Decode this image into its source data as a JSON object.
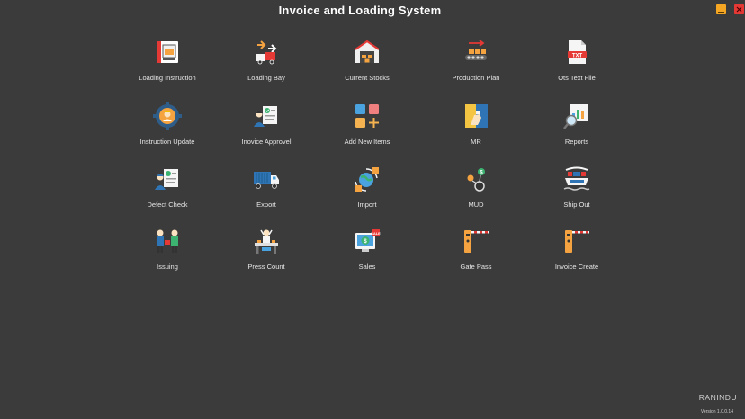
{
  "window": {
    "title": "Invoice and Loading System",
    "minimize_color": "#f5a623",
    "close_color": "#e53935"
  },
  "menu": [
    {
      "label": "Loading Instruction",
      "icon": "loading-instruction-icon"
    },
    {
      "label": "Loading Bay",
      "icon": "loading-bay-icon"
    },
    {
      "label": "Current Stocks",
      "icon": "warehouse-icon"
    },
    {
      "label": "Production Plan",
      "icon": "conveyor-icon"
    },
    {
      "label": "Ots Text File",
      "icon": "txt-file-icon"
    },
    {
      "label": "Instruction  Update",
      "icon": "gear-worker-icon"
    },
    {
      "label": "Inovice Approvel",
      "icon": "approval-icon"
    },
    {
      "label": "Add New Items",
      "icon": "add-items-icon"
    },
    {
      "label": "MR",
      "icon": "mr-icon"
    },
    {
      "label": "Reports",
      "icon": "reports-icon"
    },
    {
      "label": "Defect Check",
      "icon": "defect-check-icon"
    },
    {
      "label": "Export",
      "icon": "export-truck-icon"
    },
    {
      "label": "Import",
      "icon": "import-globe-icon"
    },
    {
      "label": "MUD",
      "icon": "mud-icon"
    },
    {
      "label": "Ship Out",
      "icon": "ship-out-icon"
    },
    {
      "label": "Issuing",
      "icon": "issuing-icon"
    },
    {
      "label": "Press Count",
      "icon": "press-count-icon"
    },
    {
      "label": "Sales",
      "icon": "sales-icon"
    },
    {
      "label": "Gate Pass",
      "icon": "gate-pass-icon"
    },
    {
      "label": "Invoice Create",
      "icon": "invoice-create-icon"
    }
  ],
  "footer": {
    "brand": "RANINDU",
    "version": "Version 1.0.0.14"
  }
}
